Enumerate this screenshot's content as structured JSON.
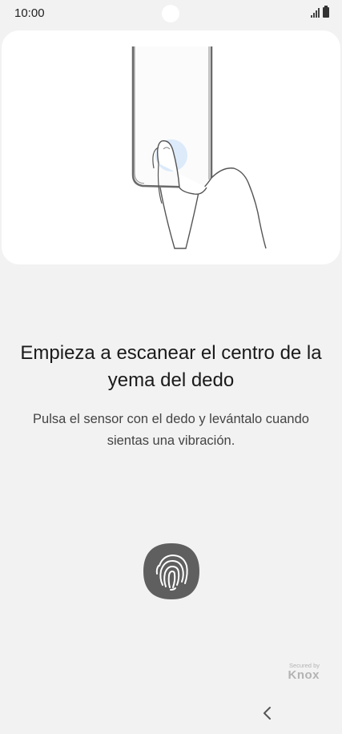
{
  "status_bar": {
    "time": "10:00"
  },
  "main": {
    "title": "Empieza a escanear el centro de la yema del dedo",
    "subtitle": "Pulsa el sensor con el dedo y levántalo cuando sientas una vibración."
  },
  "branding": {
    "knox_small": "Secured by",
    "knox_big": "Knox"
  },
  "icons": {
    "signal": "signal-icon",
    "battery": "battery-icon",
    "fingerprint": "fingerprint-icon",
    "back": "back-chevron-icon",
    "illustration": "hand-phone-illustration"
  },
  "colors": {
    "background": "#f2f2f2",
    "card": "#ffffff",
    "sensor": "#5f5f5f"
  }
}
